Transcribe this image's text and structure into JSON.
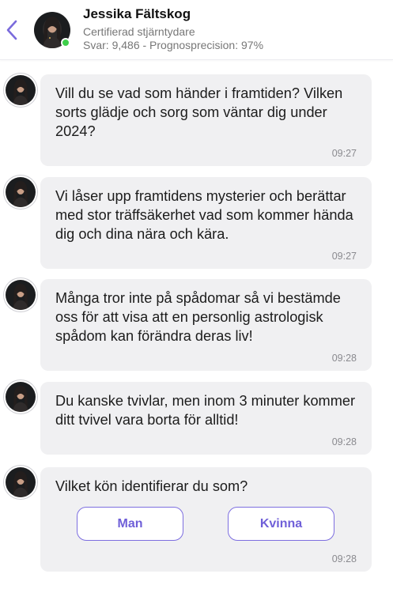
{
  "header": {
    "name": "Jessika Fältskog",
    "subtitle": "Certifierad stjärntydare",
    "stats": "Svar: 9,486 - Prognosprecision: 97%",
    "online_color": "#3ecf4a",
    "back_icon": "chevron-left-icon"
  },
  "messages": [
    {
      "text": "Vill du se vad som händer i framtiden? Vilken sorts glädje och sorg som väntar dig under 2024?",
      "time": "09:27"
    },
    {
      "text": "Vi låser upp framtidens mysterier och berättar med stor träffsäkerhet vad som kommer hända dig och dina nära och kära.",
      "time": "09:27"
    },
    {
      "text": "Många tror inte på spådomar så vi bestämde oss för att visa att en personlig astrologisk spådom kan förändra deras liv!",
      "time": "09:28"
    },
    {
      "text": "Du kanske tvivlar, men inom 3 minuter kommer ditt tvivel vara borta för alltid!",
      "time": "09:28"
    },
    {
      "text": "Vilket kön identifierar du som?",
      "time": "09:28"
    }
  ],
  "choices": {
    "male_label": "Man",
    "female_label": "Kvinna"
  },
  "colors": {
    "accent": "#6f5fd8",
    "bubble": "#f0f0f2",
    "timestamp": "#8a8a8f"
  }
}
